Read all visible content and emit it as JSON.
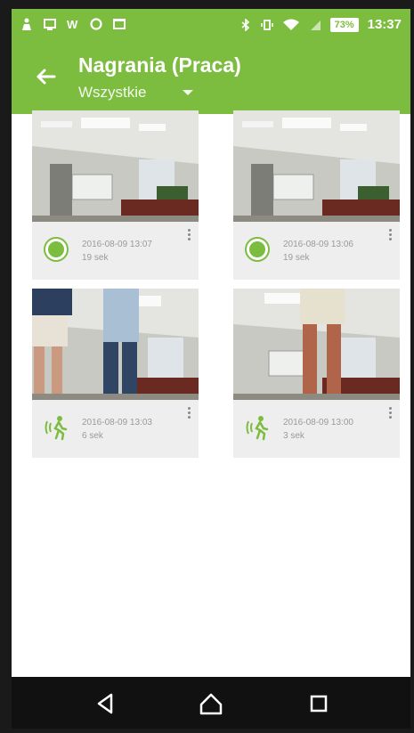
{
  "status_bar": {
    "battery_label": "73%",
    "time": "13:37",
    "left_icons": [
      "person-icon",
      "tablet-icon",
      "w-icon",
      "circle-icon",
      "gallery-icon"
    ],
    "right_icons": [
      "bluetooth-icon",
      "vibrate-icon",
      "wifi-icon",
      "signal-icon"
    ]
  },
  "app_bar": {
    "title": "Nagrania (Praca)",
    "filter_label": "Wszystkie",
    "color": "#7cbd3f"
  },
  "recordings": [
    {
      "date": "2016-08-09 13:07",
      "duration": "19 sek",
      "type": "record"
    },
    {
      "date": "2016-08-09 13:06",
      "duration": "19 sek",
      "type": "record"
    },
    {
      "date": "2016-08-09 13:03",
      "duration": "6 sek",
      "type": "motion"
    },
    {
      "date": "2016-08-09 13:00",
      "duration": "3 sek",
      "type": "motion"
    }
  ],
  "nav_bar": {
    "buttons": [
      "back-triangle-icon",
      "home-icon",
      "recents-icon"
    ]
  }
}
